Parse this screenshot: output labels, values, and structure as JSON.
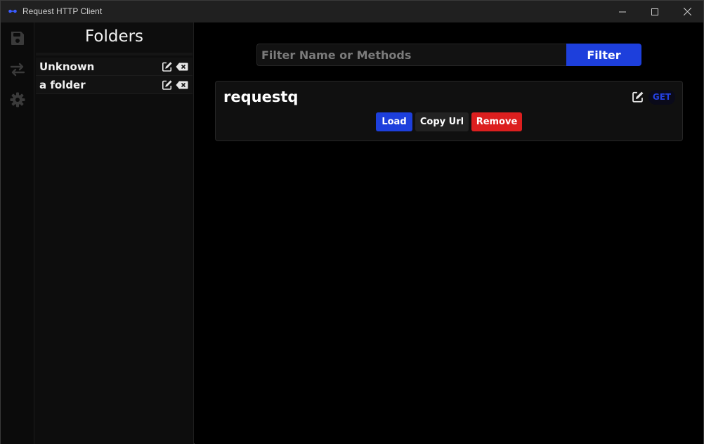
{
  "window": {
    "title": "Request HTTP Client",
    "accent_color": "#1d3fdc",
    "danger_color": "#dc1f1f"
  },
  "rail": {
    "icons": [
      "save-icon",
      "transfer-icon",
      "gear-icon"
    ]
  },
  "folders": {
    "title": "Folders",
    "items": [
      {
        "label": "Unknown"
      },
      {
        "label": "a folder"
      }
    ]
  },
  "filter": {
    "placeholder": "Filter Name or Methods",
    "value": "",
    "button_label": "Filter"
  },
  "requests": [
    {
      "name": "requestq",
      "method": "GET",
      "actions": {
        "load": "Load",
        "copy_url": "Copy Url",
        "remove": "Remove"
      }
    }
  ]
}
